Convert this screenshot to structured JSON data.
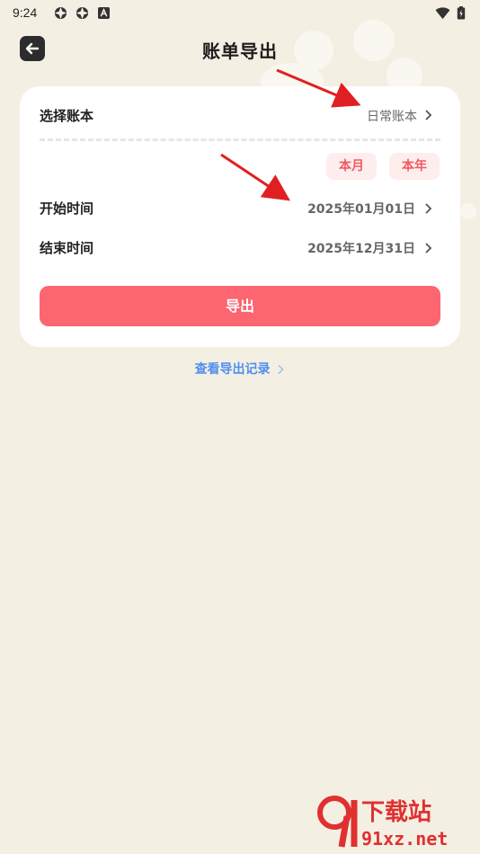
{
  "status_bar": {
    "time": "9:24"
  },
  "header": {
    "title": "账单导出"
  },
  "account_row": {
    "label": "选择账本",
    "value": "日常账本"
  },
  "quick_ranges": [
    {
      "label": "本月"
    },
    {
      "label": "本年"
    }
  ],
  "start_row": {
    "label": "开始时间",
    "value": "2025年01月01日"
  },
  "end_row": {
    "label": "结束时间",
    "value": "2025年12月31日"
  },
  "export_button": "导出",
  "records_link": "查看导出记录",
  "watermark": {
    "brand": "下载站",
    "domain": "91xz.net"
  },
  "colors": {
    "background": "#f4efe3",
    "primary": "#fb6670",
    "chip_bg": "#fdeeed",
    "link": "#4f8ff0",
    "annotation_arrow": "#e02020"
  }
}
